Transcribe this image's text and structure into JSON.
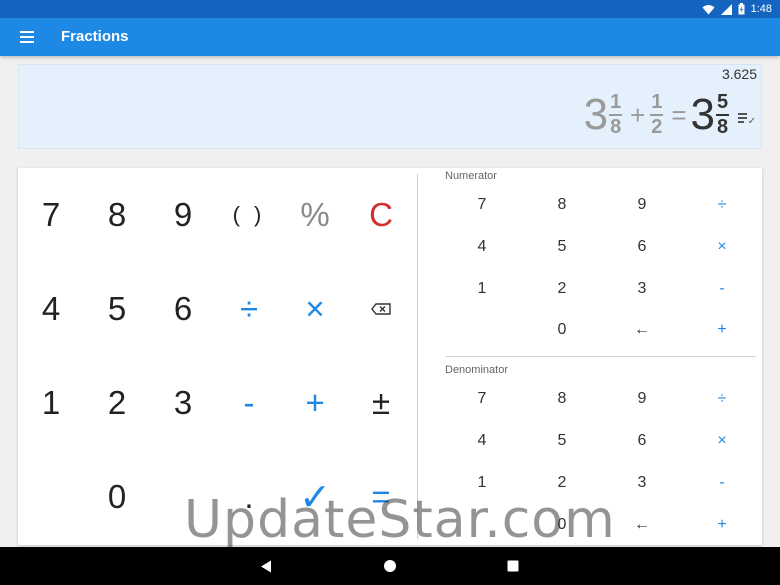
{
  "status_bar": {
    "time": "1:48",
    "icons": [
      "wifi-icon",
      "signal-icon",
      "battery-icon"
    ]
  },
  "app_bar": {
    "title": "Fractions",
    "menu_icon": "hamburger-menu-icon"
  },
  "display": {
    "decimal": "3.625",
    "expression": {
      "term1": {
        "whole": "3",
        "num": "1",
        "den": "8"
      },
      "op": "+",
      "term2": {
        "num": "1",
        "den": "2"
      },
      "equals": "=",
      "result": {
        "whole": "3",
        "num": "5",
        "den": "8"
      }
    },
    "history_icon": "history-list-icon"
  },
  "main_keypad": {
    "rows": [
      [
        "7",
        "8",
        "9",
        "( )",
        "%",
        "C"
      ],
      [
        "4",
        "5",
        "6",
        "÷",
        "×",
        "backspace"
      ],
      [
        "1",
        "2",
        "3",
        "-",
        "+",
        "±"
      ],
      [
        "",
        "0",
        ".",
        "✓",
        "="
      ]
    ]
  },
  "numerator_pad": {
    "label": "Numerator",
    "rows": [
      [
        "7",
        "8",
        "9",
        "÷"
      ],
      [
        "4",
        "5",
        "6",
        "×"
      ],
      [
        "1",
        "2",
        "3",
        "-"
      ],
      [
        "",
        "0",
        "←",
        "+"
      ]
    ]
  },
  "denominator_pad": {
    "label": "Denominator",
    "rows": [
      [
        "7",
        "8",
        "9",
        "÷"
      ],
      [
        "4",
        "5",
        "6",
        "×"
      ],
      [
        "1",
        "2",
        "3",
        "-"
      ],
      [
        "",
        "0",
        "←",
        "+"
      ]
    ]
  },
  "watermark": "UpdateStar.com",
  "colors": {
    "accent": "#1e88e5",
    "status_bar": "#1565c0",
    "clear": "#d32f2f",
    "display_bg": "#e4f1fd"
  },
  "nav": {
    "icons": [
      "back-icon",
      "home-icon",
      "recents-icon"
    ]
  }
}
